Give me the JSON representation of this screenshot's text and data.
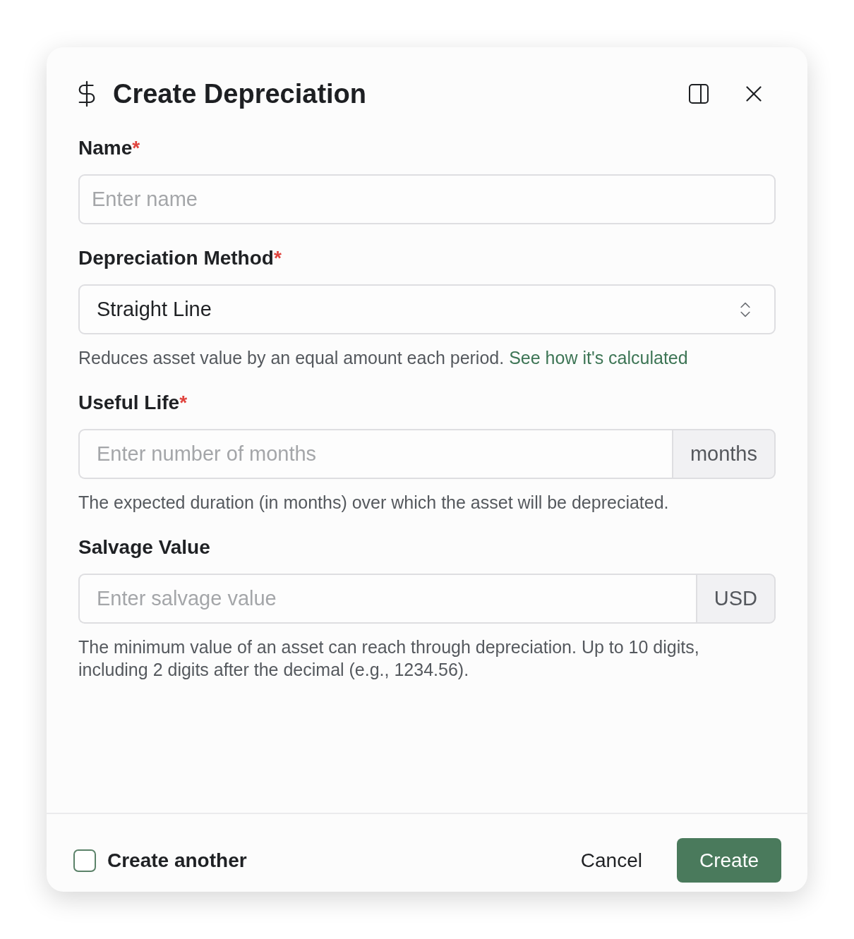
{
  "dialog": {
    "title": "Create Depreciation",
    "fields": [
      {
        "kind": "text",
        "label": "Name",
        "required_mark": "*",
        "placeholder": "Enter name"
      },
      {
        "kind": "select",
        "label": "Depreciation Method",
        "required_mark": "*",
        "value": "Straight Line",
        "helper": "Reduces asset value by an equal amount each period.",
        "helper_link": "See how it's calculated"
      },
      {
        "kind": "addon",
        "label": "Useful Life",
        "required_mark": "*",
        "placeholder": "Enter number of months",
        "addon": "months",
        "helper": "The expected duration (in months) over which the asset will be depreciated."
      },
      {
        "kind": "addon",
        "label": "Salvage Value",
        "placeholder": "Enter salvage value",
        "addon": "USD",
        "helper": "The minimum value of an asset can reach through depreciation. Up to 10 digits, including 2 digits after the decimal (e.g., 1234.56)."
      }
    ]
  },
  "footer": {
    "create_another": {
      "label": "Create another",
      "checked": false
    },
    "buttons": [
      {
        "kind": "secondary",
        "label": "Cancel"
      },
      {
        "kind": "primary",
        "label": "Create"
      }
    ]
  }
}
